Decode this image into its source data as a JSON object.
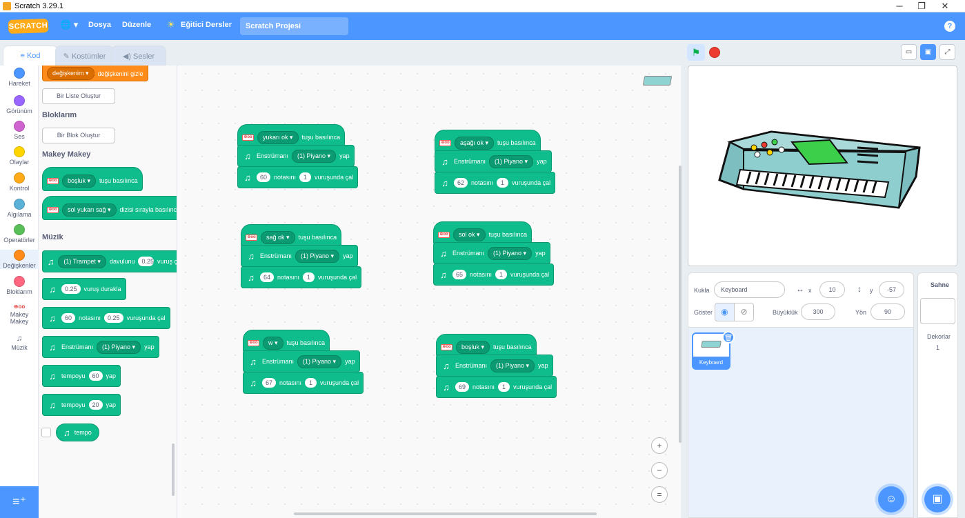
{
  "window": {
    "title": "Scratch 3.29.1",
    "minimize": "─",
    "restore": "❐",
    "close": "✕"
  },
  "menu": {
    "logo": "SCRATCH",
    "language_icon": "🌐 ▾",
    "file": "Dosya",
    "edit": "Düzenle",
    "tutorials": "Eğitici Dersler",
    "tutorials_icon": "☀",
    "project_title": "Scratch Projesi",
    "help": "?"
  },
  "tabs": {
    "code": "Kod",
    "costumes": "Kostümler",
    "sounds": "Sesler",
    "code_icon": "≡",
    "costumes_icon": "✎",
    "sounds_icon": "◀)"
  },
  "categories": [
    {
      "label": "Hareket",
      "color": "#4c97ff"
    },
    {
      "label": "Görünüm",
      "color": "#9966ff"
    },
    {
      "label": "Ses",
      "color": "#cf63cf"
    },
    {
      "label": "Olaylar",
      "color": "#ffd500"
    },
    {
      "label": "Kontrol",
      "color": "#ffab19"
    },
    {
      "label": "Algılama",
      "color": "#5cb1d6"
    },
    {
      "label": "Operatörler",
      "color": "#59c059"
    },
    {
      "label": "Değişkenler",
      "color": "#ff8c1a"
    },
    {
      "label": "Bloklarım",
      "color": "#ff6680"
    },
    {
      "label": "Makey Makey",
      "glyph": "⊕oo"
    },
    {
      "label": "Müzik",
      "glyph": "♫"
    }
  ],
  "palette": {
    "var_block": {
      "dropdown": "değişkenim ▾",
      "text": "değişkenini gizle"
    },
    "make_list": "Bir Liste Oluştur",
    "my_blocks_title": "Bloklarım",
    "make_block": "Bir Blok Oluştur",
    "makey_title": "Makey Makey",
    "makey1": {
      "dropdown": "boşluk ▾",
      "text": "tuşu basılınca"
    },
    "makey2": {
      "dropdown": "sol yukarı sağ ▾",
      "text": "dizisi sırayla basılınca"
    },
    "music_title": "Müzik",
    "m1": {
      "dropdown": "(1) Trampet ▾",
      "text": "davulunu",
      "value": "0.25",
      "tail": "vuruş çal"
    },
    "m2": {
      "value": "0.25",
      "text": "vuruş durakla"
    },
    "m3": {
      "value": "60",
      "text": "notasını",
      "value2": "0.25",
      "tail": "vuruşunda çal"
    },
    "m4": {
      "text": "Enstrümanı",
      "dropdown": "(1) Piyano ▾",
      "tail": "yap"
    },
    "m5": {
      "text": "tempoyu",
      "value": "60",
      "tail": "yap"
    },
    "m6": {
      "text": "tempoyu",
      "value": "20",
      "tail": "yap"
    },
    "m7": {
      "text": "tempo"
    },
    "music_glyph": "♫",
    "makey_glyph": "⊕oo"
  },
  "scripts": [
    {
      "key": "yukarı ok ▾",
      "hat": "tuşu basılınca",
      "inst_label": "Enstrümanı",
      "instrument": "(1) Piyano ▾",
      "inst_tail": "yap",
      "note": "60",
      "note_label": "notasını",
      "beats": "1",
      "play_tail": "vuruşunda çal"
    },
    {
      "key": "aşağı ok ▾",
      "hat": "tuşu basılınca",
      "inst_label": "Enstrümanı",
      "instrument": "(1) Piyano ▾",
      "inst_tail": "yap",
      "note": "62",
      "note_label": "notasını",
      "beats": "1",
      "play_tail": "vuruşunda çal"
    },
    {
      "key": "sağ ok ▾",
      "hat": "tuşu basılınca",
      "inst_label": "Enstrümanı",
      "instrument": "(1) Piyano ▾",
      "inst_tail": "yap",
      "note": "64",
      "note_label": "notasını",
      "beats": "1",
      "play_tail": "vuruşunda çal"
    },
    {
      "key": "sol ok ▾",
      "hat": "tuşu basılınca",
      "inst_label": "Enstrümanı",
      "instrument": "(1) Piyano ▾",
      "inst_tail": "yap",
      "note": "65",
      "note_label": "notasını",
      "beats": "1",
      "play_tail": "vuruşunda çal"
    },
    {
      "key": "w ▾",
      "hat": "tuşu basılınca",
      "inst_label": "Enstrümanı",
      "instrument": "(1) Piyano ▾",
      "inst_tail": "yap",
      "note": "67",
      "note_label": "notasını",
      "beats": "1",
      "play_tail": "vuruşunda çal"
    },
    {
      "key": "boşluk ▾",
      "hat": "tuşu basılınca",
      "inst_label": "Enstrümanı",
      "instrument": "(1) Piyano ▾",
      "inst_tail": "yap",
      "note": "69",
      "note_label": "notasını",
      "beats": "1",
      "play_tail": "vuruşunda çal"
    }
  ],
  "zoom": {
    "in": "+",
    "out": "−",
    "reset": "="
  },
  "sprite_info": {
    "sprite_label": "Kukla",
    "sprite_name": "Keyboard",
    "x_label": "x",
    "x_value": "10",
    "y_label": "y",
    "y_value": "-57",
    "x_icon": "↔",
    "y_icon": "↕",
    "show_label": "Göster",
    "size_label": "Büyüklük",
    "size_value": "300",
    "direction_label": "Yön",
    "direction_value": "90"
  },
  "sprites": [
    {
      "name": "Keyboard"
    }
  ],
  "stage_panel": {
    "title": "Sahne",
    "backdrops_label": "Dekorlar",
    "backdrops_count": "1"
  },
  "colors": {
    "motion_blue": "#4c97ff",
    "music_green": "#0fbd8c",
    "variables_orange": "#ff8c1a"
  }
}
